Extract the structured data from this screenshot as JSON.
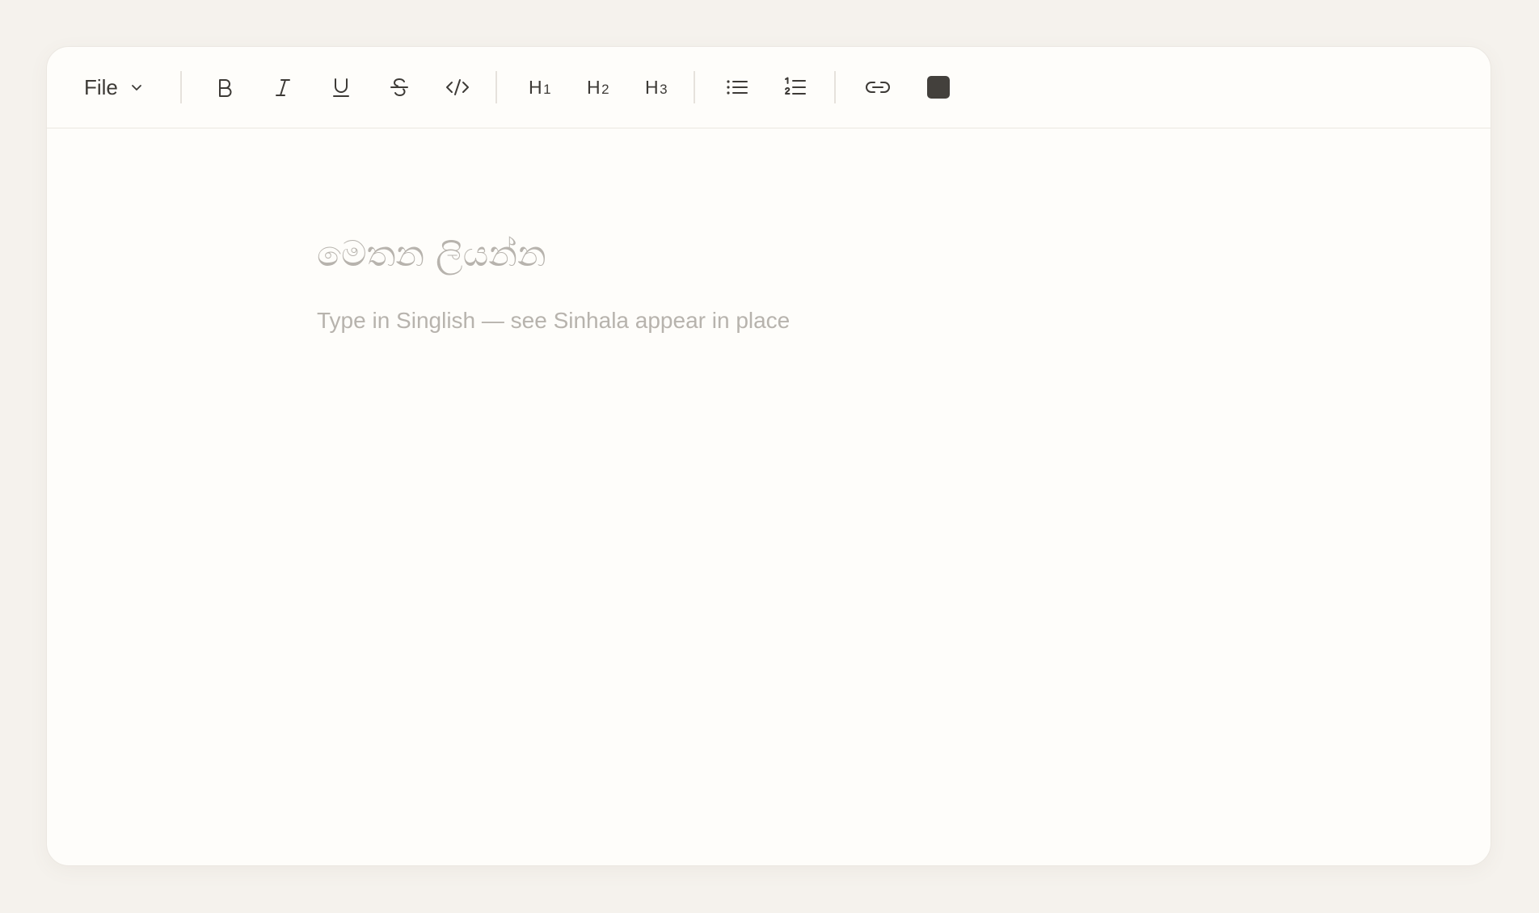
{
  "toolbar": {
    "file_label": "File",
    "heading_1": "H",
    "heading_1_level": "1",
    "heading_2": "H",
    "heading_2_level": "2",
    "heading_3": "H",
    "heading_3_level": "3",
    "icons": [
      "bold-icon",
      "italic-icon",
      "underline-icon",
      "strikethrough-icon",
      "code-icon",
      "bullet-list-icon",
      "numbered-list-icon",
      "link-icon",
      "chevron-down-icon"
    ],
    "text_color": "#43403c"
  },
  "editor": {
    "title_placeholder": "මෙතන ලියන්න",
    "body_placeholder": "Type in Singlish — see Sinhala appear in place"
  },
  "colors": {
    "background": "#f5f2ed",
    "card": "#fefdfa",
    "placeholder": "#b7b3ad",
    "icon": "#3d3a36"
  }
}
